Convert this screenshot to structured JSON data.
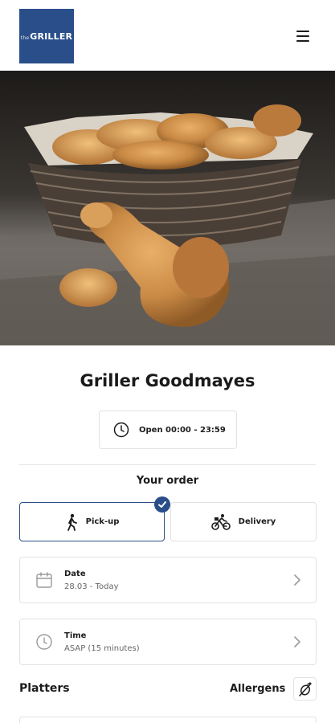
{
  "header": {
    "logo_text": "GRILLER",
    "logo_prefix": "the",
    "menu_icon": "hamburger-menu-icon"
  },
  "hero": {
    "description": "fried-chicken-basket-photo"
  },
  "restaurant": {
    "name": "Griller Goodmayes",
    "hours": "Open 00:00 - 23:59"
  },
  "order": {
    "title": "Your order",
    "options": [
      {
        "label": "Pick-up",
        "icon": "walking-person-icon",
        "selected": true
      },
      {
        "label": "Delivery",
        "icon": "bicycle-delivery-icon",
        "selected": false
      }
    ],
    "date": {
      "label": "Date",
      "value": "28.03 - Today",
      "icon": "calendar-icon"
    },
    "time": {
      "label": "Time",
      "value": "ASAP (15 minutes)",
      "icon": "clock-icon"
    }
  },
  "menu": {
    "section_title": "Platters",
    "allergens_label": "Allergens"
  },
  "colors": {
    "brand": "#2a4e8a",
    "border": "#e2e2e2",
    "text": "#1c1c1c"
  }
}
